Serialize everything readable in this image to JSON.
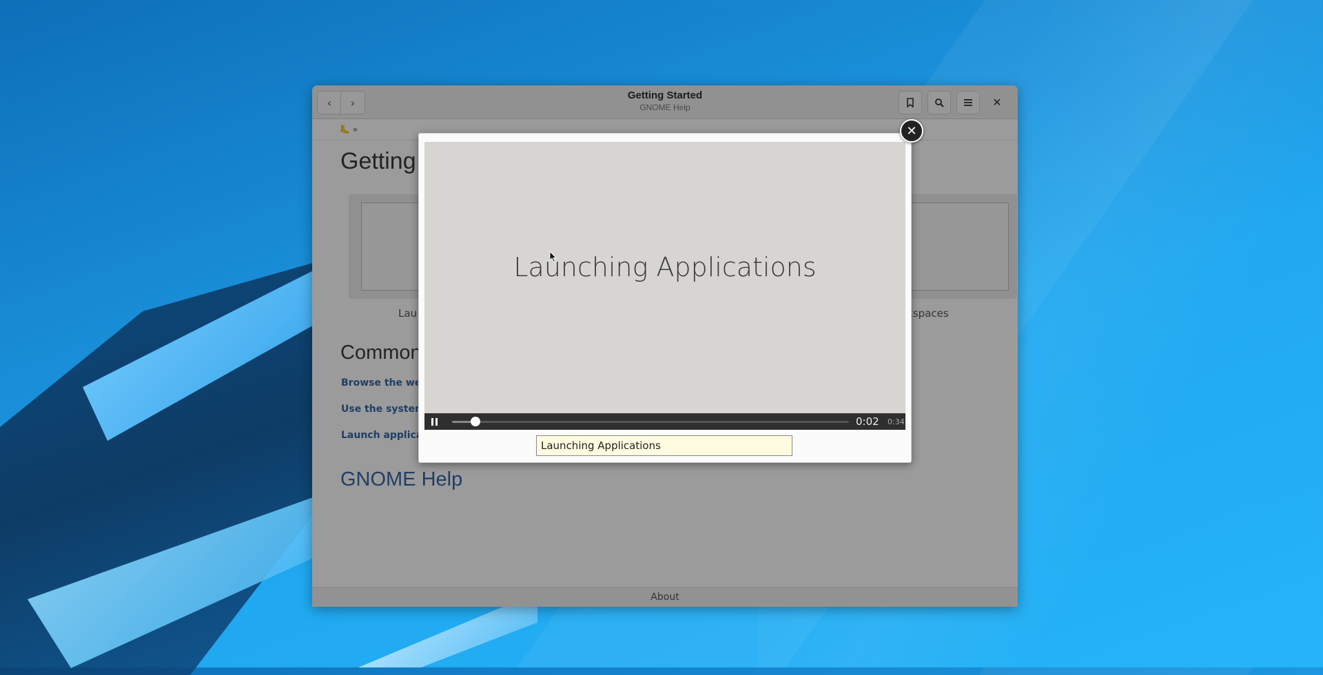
{
  "window": {
    "title": "Getting Started",
    "subtitle": "GNOME Help",
    "close_label": "✕"
  },
  "headerbar": {
    "back_icon": "‹",
    "forward_icon": "›",
    "bookmark_icon": "bookmark-icon",
    "search_icon": "search-icon",
    "menu_icon": "menu-icon"
  },
  "page": {
    "breadcrumb": "»",
    "title": "Getting",
    "thumb_left_label": "Lau",
    "thumb_right_label": "rkspaces",
    "section_title": "Common",
    "links": [
      "Browse the web",
      "Use the system s",
      "Launch applicat"
    ],
    "help_link": "GNOME Help",
    "footer": "About"
  },
  "video_dialog": {
    "caption": "Launching Applications",
    "current_time": "0:02",
    "total_time": "0:34",
    "progress_fraction": 0.059,
    "track_selected": "Launching Applications",
    "close_label": "✕"
  },
  "colors": {
    "accent_link": "#3465a4",
    "track_bg": "#fffbe0"
  }
}
